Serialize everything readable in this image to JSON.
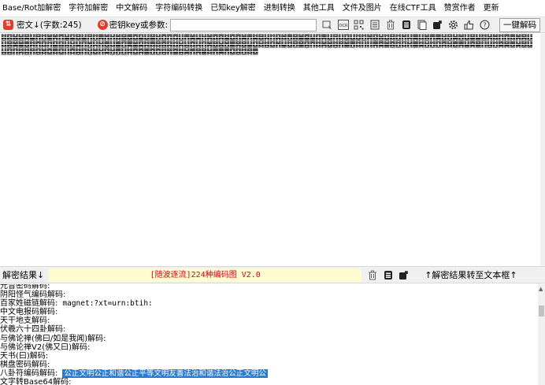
{
  "menu": [
    "Base/Rot加解密",
    "字符加解密",
    "中文解码",
    "字符编码转换",
    "已知key解密",
    "进制转换",
    "其他工具",
    "文件及图片",
    "在线CTF工具",
    "赞赏作者",
    "更新"
  ],
  "toolbar": {
    "cipher_label": "密文↓(字数:245)",
    "key_label": "密钥key或参数:",
    "key_value": "",
    "decrypt_all": "一键解码",
    "icon_ocr": "OCR"
  },
  "cipher_text": "䷾䷕䷶䷶䷱䷊䷢䷂䷪䷞䷓䷡䷙䷥䷊䷢䷂䷠䷬䷏䷮䷝䷉䷼䷙䷒䷍䷲䷩䷓䷺䷗䷋䷛䷭䷏䷞䷺䷴䷄䷼䷓䷛䷋䷯䷥䷎䷇䷳䷮䷘䷝䷪䷈䷊䷃䷠䷒䷢䷆䷨䷒䷻䷂䷞䷕䷶䷻䷿䷂䷬䷎䷫䷆䷰䷋䷫䷲䷔䷟䷐䷒䷍䷊䷾䷽䷮䷇䷓䷅䷞䷷䷗䷆䷝䷛䷪䷉䷦䷓䷃䷇䷙䷕䷣䷲䷭䷖䷐䷎䷏䷉䷆䷀䷚䷫䷪䷑䷦䷅䷿䷤䷳䷜䷽䷣䷺䷎䷖䷞䷥䷶䷐䷀䷷䷥䷊䷨䷧䷾䷨䷬䷊䷻䷔䷍䷕䷓䷜䷞䷹䷾䷢䷪䷘䷜䷁䷁䷠䷸䷪䷤䷂䷃䷏䷀䷯䷲䷂䷚䷴䷧䷉䷠䷊䷸䷍䷁䷣䷂䷸䷱䷉䷟䷥䷒䷣䷕䷖䷦䷾䷢䷕䷮䷼䷅䷨䷁䷺䷾䷖䷲䷹䷏䷑䷲䷘䷗䷦䷼䷴䷀䷩䷩䷾䷢䷈䷾䷟䷋䷷䷍䷧䷋䷫䷋䷨䷕䷂䷿䷉",
  "result_bar": {
    "label": "解密结果↓",
    "banner": "[随波逐流]224种编码图 V2.0",
    "transfer": "↑解密结果转至文本框↑"
  },
  "results": [
    {
      "label": "元音密码解码:",
      "value": ""
    },
    {
      "label": "阴阳怪气编码解码:",
      "value": ""
    },
    {
      "label": "百家姓磁链解码:",
      "value": "magnet:?xt=urn:btih:"
    },
    {
      "label": "中文电报码解码:",
      "value": ""
    },
    {
      "label": "天干地支解码:",
      "value": ""
    },
    {
      "label": "伏羲六十四卦解码:",
      "value": ""
    },
    {
      "label": "与佛论禅(佛曰/如是我闻)解码:",
      "value": ""
    },
    {
      "label": "与佛论禅V2(佛又曰)解码:",
      "value": ""
    },
    {
      "label": "天书(曰)解码:",
      "value": ""
    },
    {
      "label": "棋盘密码解码:",
      "value": ""
    },
    {
      "label": "八卦符编码解码:",
      "value": "公正文明公正和谐公正平等文明友善法治和谐法治公正文明公",
      "selected": true
    },
    {
      "label": "文字转Base64解码:",
      "value": ""
    }
  ]
}
